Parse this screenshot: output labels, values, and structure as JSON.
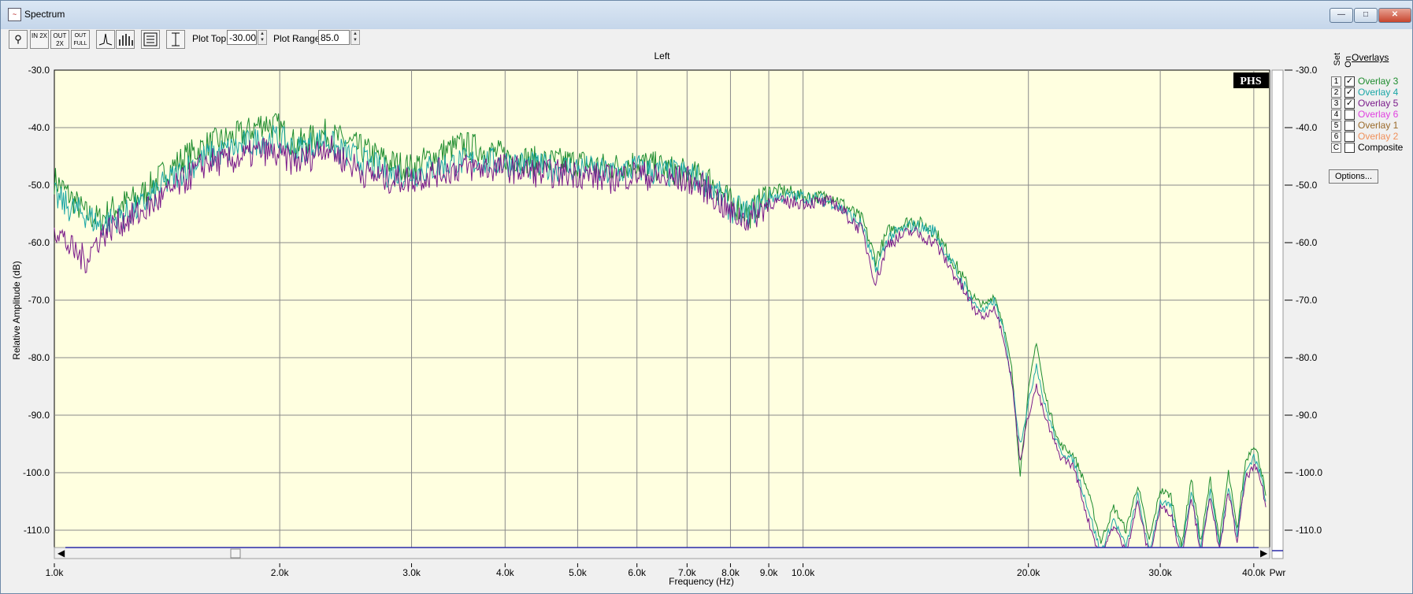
{
  "window": {
    "title": "Spectrum",
    "app_icon": "spectrum-app-icon",
    "min_symbol": "—",
    "max_symbol": "□",
    "close_symbol": "✕"
  },
  "toolbar": {
    "tools": [
      {
        "name": "zoom-tool-icon",
        "label": "🔍"
      },
      {
        "name": "zoom-in-2x-icon",
        "label": "IN 2X"
      },
      {
        "name": "zoom-out-2x-icon",
        "label": "OUT 2X"
      },
      {
        "name": "zoom-out-full-icon",
        "label": "OUT FULL"
      },
      {
        "name": "line-mode-icon",
        "label": "⸍"
      },
      {
        "name": "bar-mode-icon",
        "label": "▓"
      },
      {
        "name": "settings-list-icon",
        "label": "☰"
      },
      {
        "name": "autoscale-icon",
        "label": "↕"
      }
    ],
    "plot_top_label": "Plot Top:",
    "plot_top_value": "-30.00",
    "plot_range_label": "Plot Range:",
    "plot_range_value": "85.0"
  },
  "overlays": {
    "title": "Overlays",
    "set_header": "Set",
    "on_header": "On",
    "items": [
      {
        "set": "1",
        "label": "Overlay 3",
        "checked": true,
        "color": "#1e8c2e"
      },
      {
        "set": "2",
        "label": "Overlay 4",
        "checked": true,
        "color": "#1aa6a6"
      },
      {
        "set": "3",
        "label": "Overlay 5",
        "checked": true,
        "color": "#7a1a8a"
      },
      {
        "set": "4",
        "label": "Overlay 6",
        "checked": false,
        "color": "#e040e0"
      },
      {
        "set": "5",
        "label": "Overlay 1",
        "checked": false,
        "color": "#9a6a2a"
      },
      {
        "set": "6",
        "label": "Overlay 2",
        "checked": false,
        "color": "#f0905a"
      },
      {
        "set": "C",
        "label": "Composite",
        "checked": false,
        "color": "#000000"
      }
    ],
    "options_label": "Options..."
  },
  "chart_data": {
    "type": "line",
    "title": "Left",
    "xlabel": "Frequency (Hz)",
    "ylabel": "Relative Amplitude (dB)",
    "x_scale": "log",
    "xlim": [
      1000,
      42000
    ],
    "ylim": [
      -115,
      -30
    ],
    "x_ticks": [
      {
        "v": 1000,
        "t": "1.0k"
      },
      {
        "v": 2000,
        "t": "2.0k"
      },
      {
        "v": 3000,
        "t": "3.0k"
      },
      {
        "v": 4000,
        "t": "4.0k"
      },
      {
        "v": 5000,
        "t": "5.0k"
      },
      {
        "v": 6000,
        "t": "6.0k"
      },
      {
        "v": 7000,
        "t": "7.0k"
      },
      {
        "v": 8000,
        "t": "8.0k"
      },
      {
        "v": 9000,
        "t": "9.0k"
      },
      {
        "v": 10000,
        "t": "10.0k"
      },
      {
        "v": 20000,
        "t": "20.0k"
      },
      {
        "v": 30000,
        "t": "30.0k"
      },
      {
        "v": 40000,
        "t": "40.0k"
      }
    ],
    "y_ticks": [
      "-30.0",
      "-40.0",
      "-50.0",
      "-60.0",
      "-70.0",
      "-80.0",
      "-90.0",
      "-100.0",
      "-110.0"
    ],
    "y_tick_values": [
      -30,
      -40,
      -50,
      -60,
      -70,
      -80,
      -90,
      -100,
      -110
    ],
    "pwr_label": "Pwr",
    "logo": "PHS",
    "grid": true,
    "series": [
      {
        "name": "Overlay 3",
        "color": "#1e8c2e",
        "points": [
          [
            1000,
            -49
          ],
          [
            1050,
            -52
          ],
          [
            1100,
            -55
          ],
          [
            1150,
            -56
          ],
          [
            1200,
            -54
          ],
          [
            1300,
            -52
          ],
          [
            1400,
            -48
          ],
          [
            1500,
            -45
          ],
          [
            1600,
            -43
          ],
          [
            1700,
            -42
          ],
          [
            1800,
            -41
          ],
          [
            1900,
            -39
          ],
          [
            2000,
            -40
          ],
          [
            2100,
            -43
          ],
          [
            2200,
            -42
          ],
          [
            2300,
            -41
          ],
          [
            2400,
            -42
          ],
          [
            2600,
            -44
          ],
          [
            2800,
            -46
          ],
          [
            3000,
            -47
          ],
          [
            3200,
            -45
          ],
          [
            3500,
            -43
          ],
          [
            3800,
            -44
          ],
          [
            4000,
            -45
          ],
          [
            4500,
            -46
          ],
          [
            5000,
            -46
          ],
          [
            5500,
            -47
          ],
          [
            6000,
            -46
          ],
          [
            6500,
            -47
          ],
          [
            7000,
            -48
          ],
          [
            7500,
            -49
          ],
          [
            8000,
            -53
          ],
          [
            8500,
            -55
          ],
          [
            9000,
            -51
          ],
          [
            9500,
            -51
          ],
          [
            10000,
            -52
          ],
          [
            11000,
            -52
          ],
          [
            12000,
            -56
          ],
          [
            12500,
            -63
          ],
          [
            13000,
            -58
          ],
          [
            14000,
            -56
          ],
          [
            15000,
            -58
          ],
          [
            16000,
            -64
          ],
          [
            17000,
            -70
          ],
          [
            17500,
            -71
          ],
          [
            18000,
            -69
          ],
          [
            18500,
            -74
          ],
          [
            19000,
            -82
          ],
          [
            19500,
            -100
          ],
          [
            20000,
            -86
          ],
          [
            20500,
            -77
          ],
          [
            21000,
            -86
          ],
          [
            22000,
            -95
          ],
          [
            23000,
            -97
          ],
          [
            24000,
            -103
          ],
          [
            25000,
            -112
          ],
          [
            26000,
            -106
          ],
          [
            27000,
            -110
          ],
          [
            28000,
            -102
          ],
          [
            29000,
            -112
          ],
          [
            30000,
            -103
          ],
          [
            31000,
            -104
          ],
          [
            32000,
            -113
          ],
          [
            33000,
            -101
          ],
          [
            34000,
            -112
          ],
          [
            35000,
            -101
          ],
          [
            36000,
            -112
          ],
          [
            37000,
            -100
          ],
          [
            38000,
            -110
          ],
          [
            39000,
            -98
          ],
          [
            40000,
            -95
          ],
          [
            40500,
            -97
          ],
          [
            41000,
            -100
          ],
          [
            41500,
            -104
          ]
        ]
      },
      {
        "name": "Overlay 4",
        "color": "#1aa6a6",
        "points": [
          [
            1000,
            -52
          ],
          [
            1050,
            -54
          ],
          [
            1100,
            -55
          ],
          [
            1150,
            -57
          ],
          [
            1200,
            -56
          ],
          [
            1300,
            -54
          ],
          [
            1400,
            -50
          ],
          [
            1500,
            -47
          ],
          [
            1600,
            -45
          ],
          [
            1700,
            -44
          ],
          [
            1800,
            -43
          ],
          [
            1900,
            -42
          ],
          [
            2000,
            -42
          ],
          [
            2100,
            -44
          ],
          [
            2200,
            -43
          ],
          [
            2300,
            -42
          ],
          [
            2400,
            -44
          ],
          [
            2600,
            -46
          ],
          [
            2800,
            -48
          ],
          [
            3000,
            -48
          ],
          [
            3200,
            -47
          ],
          [
            3500,
            -46
          ],
          [
            3800,
            -46
          ],
          [
            4000,
            -46
          ],
          [
            4500,
            -47
          ],
          [
            5000,
            -47
          ],
          [
            5500,
            -48
          ],
          [
            6000,
            -47
          ],
          [
            6500,
            -48
          ],
          [
            7000,
            -48
          ],
          [
            7500,
            -50
          ],
          [
            8000,
            -54
          ],
          [
            8500,
            -55
          ],
          [
            9000,
            -52
          ],
          [
            9500,
            -52
          ],
          [
            10000,
            -52
          ],
          [
            11000,
            -53
          ],
          [
            12000,
            -57
          ],
          [
            12500,
            -65
          ],
          [
            13000,
            -59
          ],
          [
            14000,
            -57
          ],
          [
            15000,
            -58
          ],
          [
            16000,
            -65
          ],
          [
            17000,
            -71
          ],
          [
            17500,
            -72
          ],
          [
            18000,
            -70
          ],
          [
            18500,
            -75
          ],
          [
            19000,
            -84
          ],
          [
            19500,
            -95
          ],
          [
            20000,
            -88
          ],
          [
            20500,
            -81
          ],
          [
            21000,
            -88
          ],
          [
            22000,
            -96
          ],
          [
            23000,
            -98
          ],
          [
            24000,
            -106
          ],
          [
            25000,
            -114
          ],
          [
            26000,
            -108
          ],
          [
            27000,
            -113
          ],
          [
            28000,
            -104
          ],
          [
            29000,
            -114
          ],
          [
            30000,
            -105
          ],
          [
            31000,
            -106
          ],
          [
            32000,
            -114
          ],
          [
            33000,
            -103
          ],
          [
            34000,
            -113
          ],
          [
            35000,
            -103
          ],
          [
            36000,
            -113
          ],
          [
            37000,
            -102
          ],
          [
            38000,
            -111
          ],
          [
            39000,
            -100
          ],
          [
            40000,
            -97
          ],
          [
            40500,
            -99
          ],
          [
            41000,
            -101
          ],
          [
            41500,
            -105
          ]
        ]
      },
      {
        "name": "Overlay 5",
        "color": "#7a1a8a",
        "points": [
          [
            1000,
            -57
          ],
          [
            1050,
            -61
          ],
          [
            1100,
            -63
          ],
          [
            1150,
            -59
          ],
          [
            1200,
            -57
          ],
          [
            1300,
            -55
          ],
          [
            1400,
            -52
          ],
          [
            1500,
            -49
          ],
          [
            1600,
            -46
          ],
          [
            1700,
            -46
          ],
          [
            1800,
            -45
          ],
          [
            1900,
            -44
          ],
          [
            2000,
            -45
          ],
          [
            2100,
            -46
          ],
          [
            2200,
            -45
          ],
          [
            2300,
            -43
          ],
          [
            2400,
            -45
          ],
          [
            2600,
            -48
          ],
          [
            2800,
            -49
          ],
          [
            3000,
            -49
          ],
          [
            3200,
            -48
          ],
          [
            3500,
            -47
          ],
          [
            3800,
            -47
          ],
          [
            4000,
            -47
          ],
          [
            4500,
            -48
          ],
          [
            5000,
            -48
          ],
          [
            5500,
            -49
          ],
          [
            6000,
            -48
          ],
          [
            6500,
            -49
          ],
          [
            7000,
            -49
          ],
          [
            7500,
            -51
          ],
          [
            8000,
            -55
          ],
          [
            8500,
            -56
          ],
          [
            9000,
            -53
          ],
          [
            9500,
            -53
          ],
          [
            10000,
            -53
          ],
          [
            11000,
            -53
          ],
          [
            12000,
            -58
          ],
          [
            12500,
            -67
          ],
          [
            13000,
            -60
          ],
          [
            14000,
            -58
          ],
          [
            15000,
            -60
          ],
          [
            16000,
            -66
          ],
          [
            17000,
            -72
          ],
          [
            17500,
            -73
          ],
          [
            18000,
            -71
          ],
          [
            18500,
            -76
          ],
          [
            19000,
            -84
          ],
          [
            19500,
            -98
          ],
          [
            20000,
            -90
          ],
          [
            20500,
            -85
          ],
          [
            21000,
            -90
          ],
          [
            22000,
            -97
          ],
          [
            23000,
            -99
          ],
          [
            24000,
            -108
          ],
          [
            25000,
            -115
          ],
          [
            26000,
            -109
          ],
          [
            27000,
            -114
          ],
          [
            28000,
            -105
          ],
          [
            29000,
            -115
          ],
          [
            30000,
            -106
          ],
          [
            31000,
            -107
          ],
          [
            32000,
            -115
          ],
          [
            33000,
            -104
          ],
          [
            34000,
            -114
          ],
          [
            35000,
            -104
          ],
          [
            36000,
            -114
          ],
          [
            37000,
            -103
          ],
          [
            38000,
            -112
          ],
          [
            39000,
            -101
          ],
          [
            40000,
            -99
          ],
          [
            40500,
            -100
          ],
          [
            41000,
            -102
          ],
          [
            41500,
            -106
          ]
        ]
      }
    ]
  }
}
